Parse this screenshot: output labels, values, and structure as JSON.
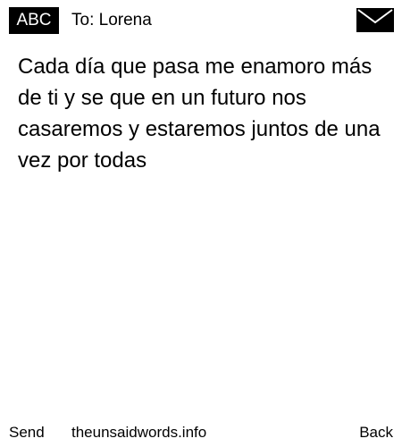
{
  "header": {
    "badge_label": "ABC",
    "recipient_line": "To: Lorena",
    "envelope_icon": "envelope-icon"
  },
  "message": {
    "body": "Cada día que pasa me enamoro más de ti y se que en un futuro nos casaremos y estaremos juntos de una vez por todas"
  },
  "footer": {
    "send_label": "Send",
    "site_label": "theunsaidwords.info",
    "back_label": "Back"
  },
  "colors": {
    "background": "#ffffff",
    "text": "#000000",
    "badge_background": "#000000",
    "badge_text": "#ffffff"
  }
}
